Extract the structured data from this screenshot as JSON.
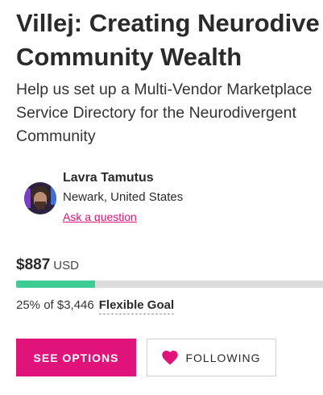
{
  "campaign": {
    "title_lines": [
      "Villej: Creating Neurodive",
      "Community Wealth"
    ],
    "tagline_lines": [
      "Help us set up a Multi-Vendor Marketplace",
      "Service Directory for the Neurodivergent",
      "Community"
    ]
  },
  "owner": {
    "name": "Lavra Tamutus",
    "location": "Newark, United States",
    "ask_link": "Ask a question"
  },
  "funding": {
    "amount": "$887",
    "currency": "USD",
    "percent_text": "25% of $3,446",
    "percent": 25.7,
    "goal_type": "Flexible Goal"
  },
  "actions": {
    "primary_label": "SEE OPTIONS",
    "follow_label": "FOLLOWING"
  },
  "colors": {
    "accent": "#e0137a",
    "progress": "#3ecb94",
    "heart": "#e0137a"
  },
  "icons": {
    "follow_icon": "heart-icon"
  }
}
